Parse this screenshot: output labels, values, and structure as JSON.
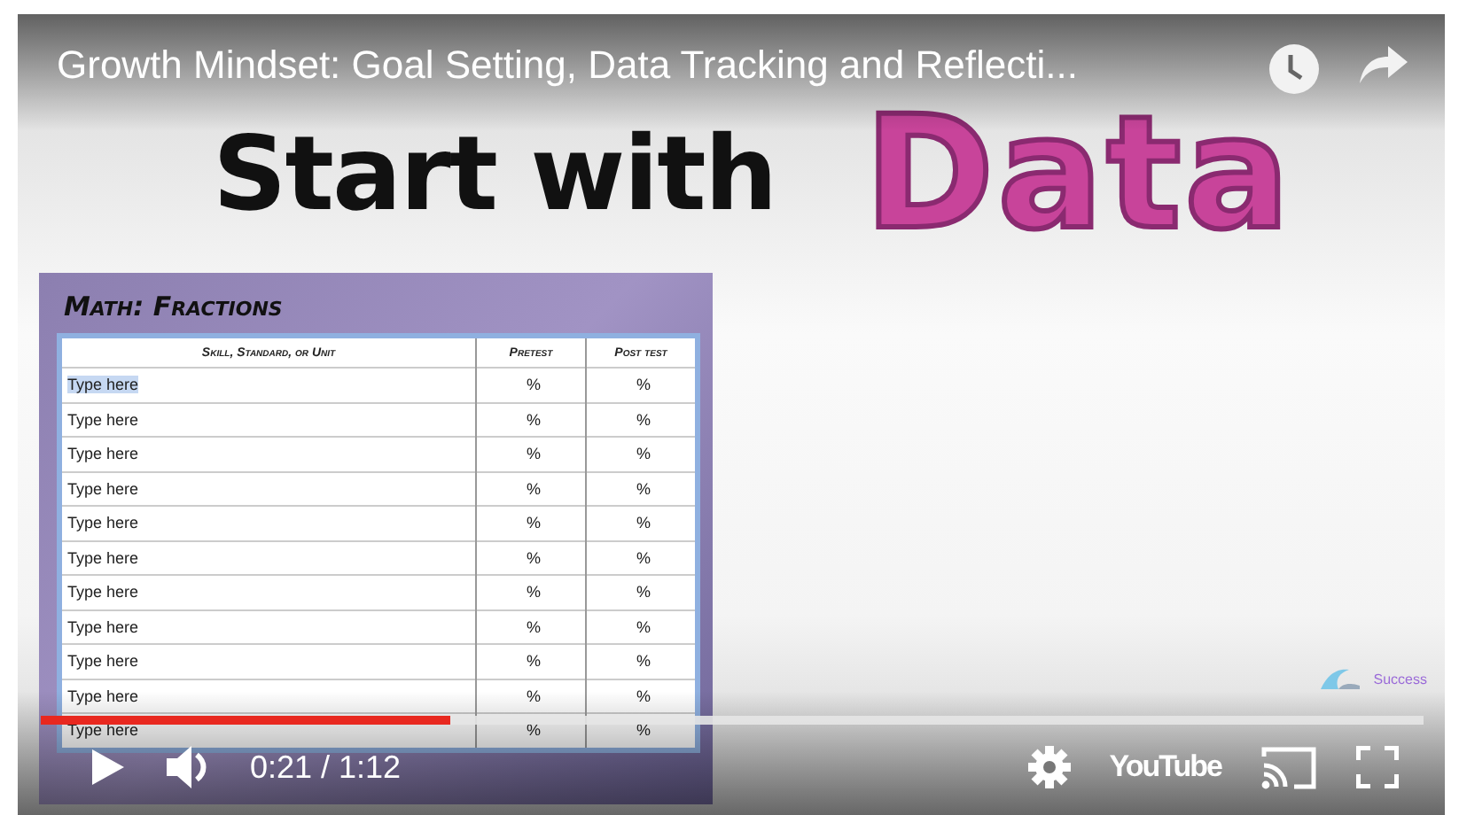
{
  "player": {
    "title": "Growth Mindset: Goal Setting, Data Tracking and Reflecti...",
    "time": "0:21 / 1:12",
    "progress": {
      "level": 0.296
    },
    "logo": "YouTube"
  },
  "slide": {
    "heading": "Start with",
    "heading_accent": "Data",
    "table_title": "Math: Fractions",
    "columns": [
      "Skill, Standard, or Unit",
      "Pretest",
      "Post test"
    ],
    "rows": [
      {
        "cells": [
          "Type here",
          "%",
          "%"
        ],
        "selected": true
      },
      {
        "cells": [
          "Type here",
          "%",
          "%"
        ],
        "selected": false
      },
      {
        "cells": [
          "Type here",
          "%",
          "%"
        ],
        "selected": false
      },
      {
        "cells": [
          "Type here",
          "%",
          "%"
        ],
        "selected": false
      },
      {
        "cells": [
          "Type here",
          "%",
          "%"
        ],
        "selected": false
      },
      {
        "cells": [
          "Type here",
          "%",
          "%"
        ],
        "selected": false
      },
      {
        "cells": [
          "Type here",
          "%",
          "%"
        ],
        "selected": false
      },
      {
        "cells": [
          "Type here",
          "%",
          "%"
        ],
        "selected": false
      },
      {
        "cells": [
          "Type here",
          "%",
          "%"
        ],
        "selected": false
      },
      {
        "cells": [
          "Type here",
          "%",
          "%"
        ],
        "selected": false
      },
      {
        "cells": [
          "Type here",
          "%",
          "%"
        ],
        "selected": false
      }
    ],
    "brand": "Success"
  }
}
